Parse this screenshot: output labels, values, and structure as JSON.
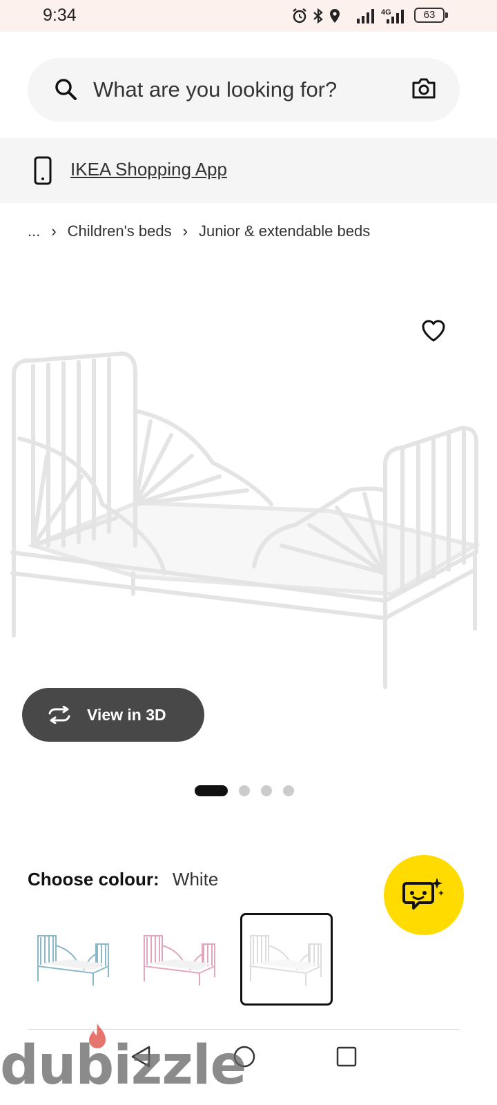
{
  "status_bar": {
    "time": "9:34",
    "battery": "63",
    "network": "4G"
  },
  "search": {
    "placeholder": "What are you looking for?",
    "icon": "search-icon",
    "camera_icon": "camera-icon"
  },
  "app_banner": {
    "icon": "phone-icon",
    "link": "IKEA Shopping App"
  },
  "breadcrumb": {
    "items": [
      "...",
      "Children's beds",
      "Junior & extendable beds"
    ]
  },
  "product": {
    "view_3d_label": "View in 3D",
    "carousel": {
      "total": 4,
      "active": 1
    },
    "colour_label": "Choose colour:",
    "colour_value": "White",
    "swatches": [
      {
        "colour": "light blue",
        "hex": "#8ab8c8",
        "selected": false
      },
      {
        "colour": "pink",
        "hex": "#e2a7c0",
        "selected": false
      },
      {
        "colour": "White",
        "hex": "#dddddd",
        "selected": true
      }
    ]
  },
  "fab": {
    "icon": "chat-assistant-icon",
    "color": "#ffdb00"
  },
  "watermark": {
    "text": "dubizzle"
  },
  "colors": {
    "accent_yellow": "#ffdb00",
    "button_dark": "#484848",
    "status_bar_bg": "#fdf1ee"
  }
}
